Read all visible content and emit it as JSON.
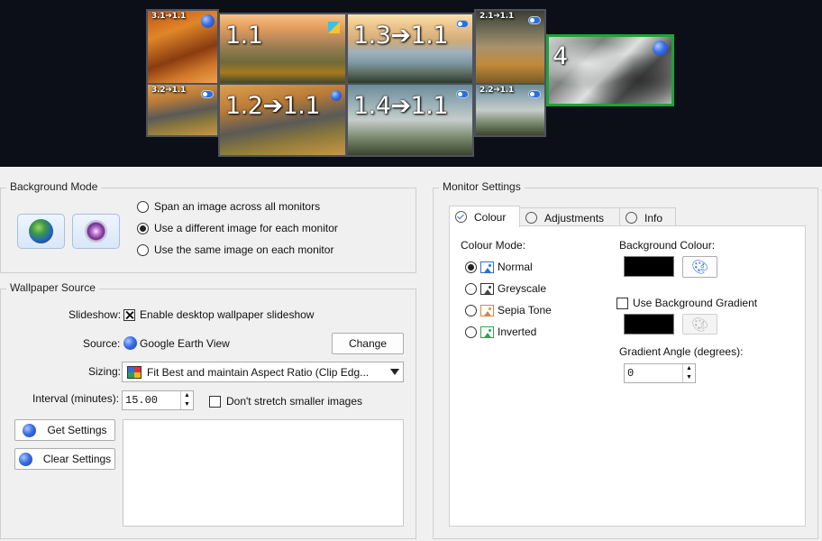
{
  "preview": {
    "tiles": {
      "t31": "3.1➔1.1",
      "t32": "3.2➔1.1",
      "t11": "1.1",
      "t12": "1.2➔1.1",
      "t13": "1.3➔1.1",
      "t14": "1.4➔1.1",
      "t21": "2.1➔1.1",
      "t22": "2.2➔1.1",
      "t4": "4"
    },
    "selected_monitor_color": "#1fa33a"
  },
  "background_mode": {
    "title": "Background Mode",
    "options": [
      {
        "label": "Span an image across all monitors",
        "checked": false
      },
      {
        "label": "Use a different image for each monitor",
        "checked": true
      },
      {
        "label": "Use the same image on each monitor",
        "checked": false
      }
    ]
  },
  "wallpaper_source": {
    "title": "Wallpaper Source",
    "slideshow_label": "Slideshow:",
    "slideshow_checkbox": "Enable desktop wallpaper slideshow",
    "slideshow_enabled": true,
    "source_label": "Source:",
    "source_value": "Google Earth View",
    "change_button": "Change",
    "sizing_label": "Sizing:",
    "sizing_value": "Fit Best and maintain Aspect Ratio (Clip Edg...",
    "interval_label": "Interval (minutes):",
    "interval_value": "15.00",
    "dont_stretch": "Don't stretch smaller images",
    "dont_stretch_checked": false,
    "get_settings": "Get Settings",
    "clear_settings": "Clear Settings"
  },
  "monitor_settings": {
    "title": "Monitor Settings",
    "tabs": [
      "Colour",
      "Adjustments",
      "Info"
    ],
    "colour_mode_label": "Colour Mode:",
    "modes": [
      {
        "label": "Normal",
        "checked": true,
        "color": "#2a6fd0"
      },
      {
        "label": "Greyscale",
        "checked": false,
        "color": "#444444"
      },
      {
        "label": "Sepia Tone",
        "checked": false,
        "color": "#c98a52"
      },
      {
        "label": "Inverted",
        "checked": false,
        "color": "#2aa84a"
      }
    ],
    "background_colour_label": "Background Colour:",
    "use_gradient": "Use Background Gradient",
    "use_gradient_checked": false,
    "gradient_angle_label": "Gradient Angle (degrees):",
    "gradient_angle_value": "0",
    "background_colour": "#000000",
    "gradient_colour": "#000000"
  }
}
